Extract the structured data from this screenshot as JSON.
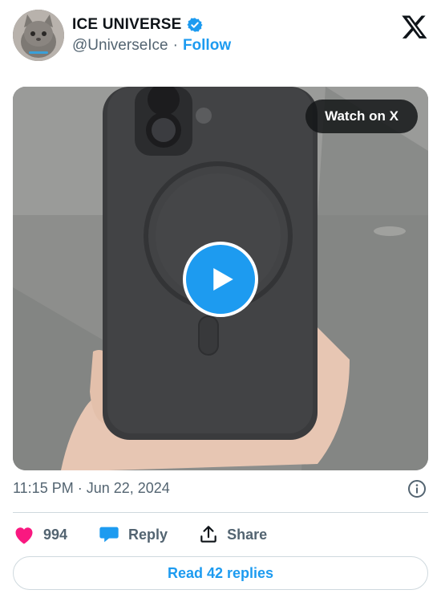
{
  "author": {
    "display_name": "ICE UNIVERSE",
    "handle": "@UniverseIce",
    "separator": "·",
    "follow_label": "Follow"
  },
  "media": {
    "watch_label": "Watch on X"
  },
  "post": {
    "timestamp": "11:15 PM · Jun 22, 2024"
  },
  "actions": {
    "likes": "994",
    "reply_label": "Reply",
    "share_label": "Share"
  },
  "read_replies_label": "Read 42 replies",
  "colors": {
    "accent": "#1d9bf0",
    "like": "#f91880",
    "muted_text": "#536471",
    "divider": "#cfd9de"
  },
  "icons": [
    "verified-badge-icon",
    "x-logo-icon",
    "play-icon",
    "info-icon",
    "heart-icon",
    "reply-bubble-icon",
    "share-icon"
  ]
}
